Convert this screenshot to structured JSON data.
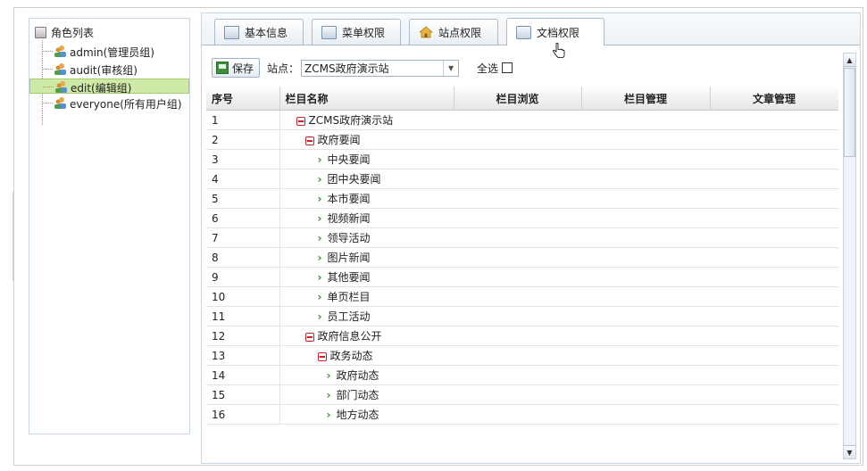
{
  "tree": {
    "root_label": "角色列表",
    "items": [
      {
        "label": "admin(管理员组)",
        "selected": false
      },
      {
        "label": "audit(审核组)",
        "selected": false
      },
      {
        "label": "edit(编辑组)",
        "selected": true
      },
      {
        "label": "everyone(所有用户组)",
        "selected": false
      }
    ]
  },
  "tabs": [
    {
      "label": "基本信息",
      "icon": "window-icon",
      "active": false
    },
    {
      "label": "菜单权限",
      "icon": "window-icon",
      "active": false
    },
    {
      "label": "站点权限",
      "icon": "house-icon",
      "active": false
    },
    {
      "label": "文档权限",
      "icon": "document-icon",
      "active": true
    }
  ],
  "toolbar": {
    "save_label": "保存",
    "site_label": "站点：",
    "site_value": "ZCMS政府演示站",
    "select_all_label": "全选"
  },
  "table": {
    "headers": [
      "序号",
      "栏目名称",
      "栏目浏览",
      "栏目管理",
      "文章管理"
    ],
    "rows": [
      {
        "seq": "1",
        "name": "ZCMS政府演示站",
        "level": 0,
        "type": "minus"
      },
      {
        "seq": "2",
        "name": "政府要闻",
        "level": 1,
        "type": "minus"
      },
      {
        "seq": "3",
        "name": "中央要闻",
        "level": 2,
        "type": "leaf"
      },
      {
        "seq": "4",
        "name": "团中央要闻",
        "level": 2,
        "type": "leaf"
      },
      {
        "seq": "5",
        "name": "本市要闻",
        "level": 2,
        "type": "leaf"
      },
      {
        "seq": "6",
        "name": "视频新闻",
        "level": 2,
        "type": "leaf"
      },
      {
        "seq": "7",
        "name": "领导活动",
        "level": 2,
        "type": "leaf"
      },
      {
        "seq": "8",
        "name": "图片新闻",
        "level": 2,
        "type": "leaf"
      },
      {
        "seq": "9",
        "name": "其他要闻",
        "level": 2,
        "type": "leaf"
      },
      {
        "seq": "10",
        "name": "单页栏目",
        "level": 2,
        "type": "leaf"
      },
      {
        "seq": "11",
        "name": "员工活动",
        "level": 2,
        "type": "leaf"
      },
      {
        "seq": "12",
        "name": "政府信息公开",
        "level": 1,
        "type": "minus"
      },
      {
        "seq": "13",
        "name": "政务动态",
        "level": 2,
        "type": "minus"
      },
      {
        "seq": "14",
        "name": "政府动态",
        "level": 3,
        "type": "leaf"
      },
      {
        "seq": "15",
        "name": "部门动态",
        "level": 3,
        "type": "leaf"
      },
      {
        "seq": "16",
        "name": "地方动态",
        "level": 3,
        "type": "leaf"
      }
    ]
  },
  "colors": {
    "selected_bg": "#cfe9a6",
    "tree_minus": "#cc2222",
    "tree_chevron": "#3b8f2f",
    "border": "#aabbcc"
  }
}
